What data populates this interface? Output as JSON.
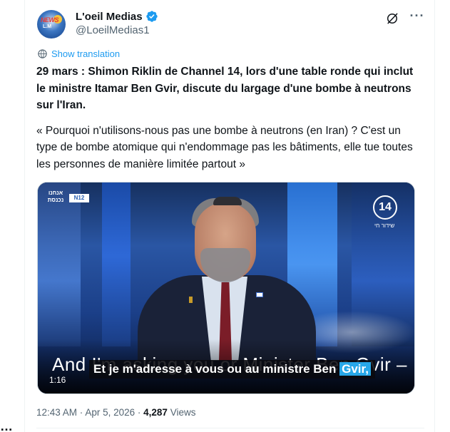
{
  "gutter": {
    "paren": ")",
    "dots": "…"
  },
  "author": {
    "display_name": "L'oeil Medias",
    "handle": "@LoeilMedias1",
    "avatar_text_top": "NEWS",
    "avatar_text_bottom": "L.M"
  },
  "actions": {
    "grok_icon": "grok-icon",
    "more_label": "···"
  },
  "translation": {
    "label": "Show translation",
    "icon": "globe-icon"
  },
  "tweet": {
    "headline": "29 mars : Shimon Riklin de Channel 14, lors d'une table ronde qui inclut le ministre Itamar Ben Gvir, discute du largage d'une bombe à neutrons sur l'Iran.",
    "quote": "« Pourquoi n'utilisons-nous pas une bombe à neutrons (en Iran) ? C'est un type de bombe atomique qui n'endommage pas les bâtiments, elle tue toutes les personnes de manière limitée partout »"
  },
  "video": {
    "logo_hebrew": "אנחנו נכנסת",
    "logo_box": "N12",
    "channel_number": "14",
    "channel_sub": "שידור חי",
    "original_subtitle": "And I'm asking you or Minister Ben Gvir –",
    "overlay_subtitle_before": "Et je m'adresse à vous ou au ministre Ben ",
    "overlay_subtitle_highlight": "Gvir,",
    "timestamp": "1:16"
  },
  "meta": {
    "time": "12:43 AM",
    "separator": " · ",
    "date": "Apr 5, 2026",
    "views_count": "4,287",
    "views_label": "Views"
  },
  "colors": {
    "link_blue": "#1d9bf0",
    "verified_blue": "#1d9bf0",
    "secondary_text": "#536471",
    "primary_text": "#0f1419"
  }
}
